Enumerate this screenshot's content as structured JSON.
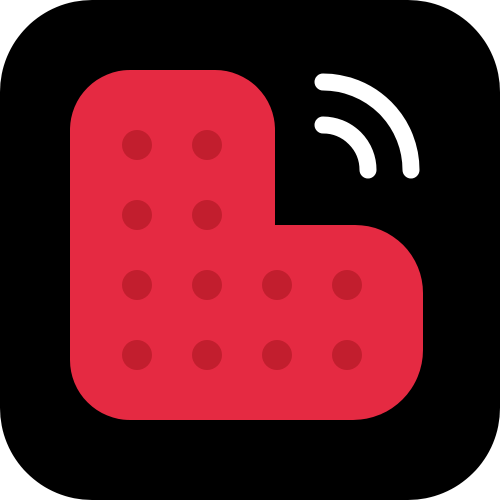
{
  "app_icon": {
    "name": "app-icon",
    "background_color": "#000000",
    "shape_color": "#e52a42",
    "dot_color": "#c21e2e",
    "signal_color": "#ffffff",
    "icons": {
      "main_shape": "l-block-heart-icon",
      "signal": "wireless-signal-icon"
    },
    "dots": {
      "rows": 4,
      "columns": 4,
      "pattern": [
        [
          1,
          1,
          0,
          0
        ],
        [
          1,
          1,
          0,
          0
        ],
        [
          1,
          1,
          1,
          1
        ],
        [
          1,
          1,
          1,
          1
        ]
      ]
    }
  }
}
